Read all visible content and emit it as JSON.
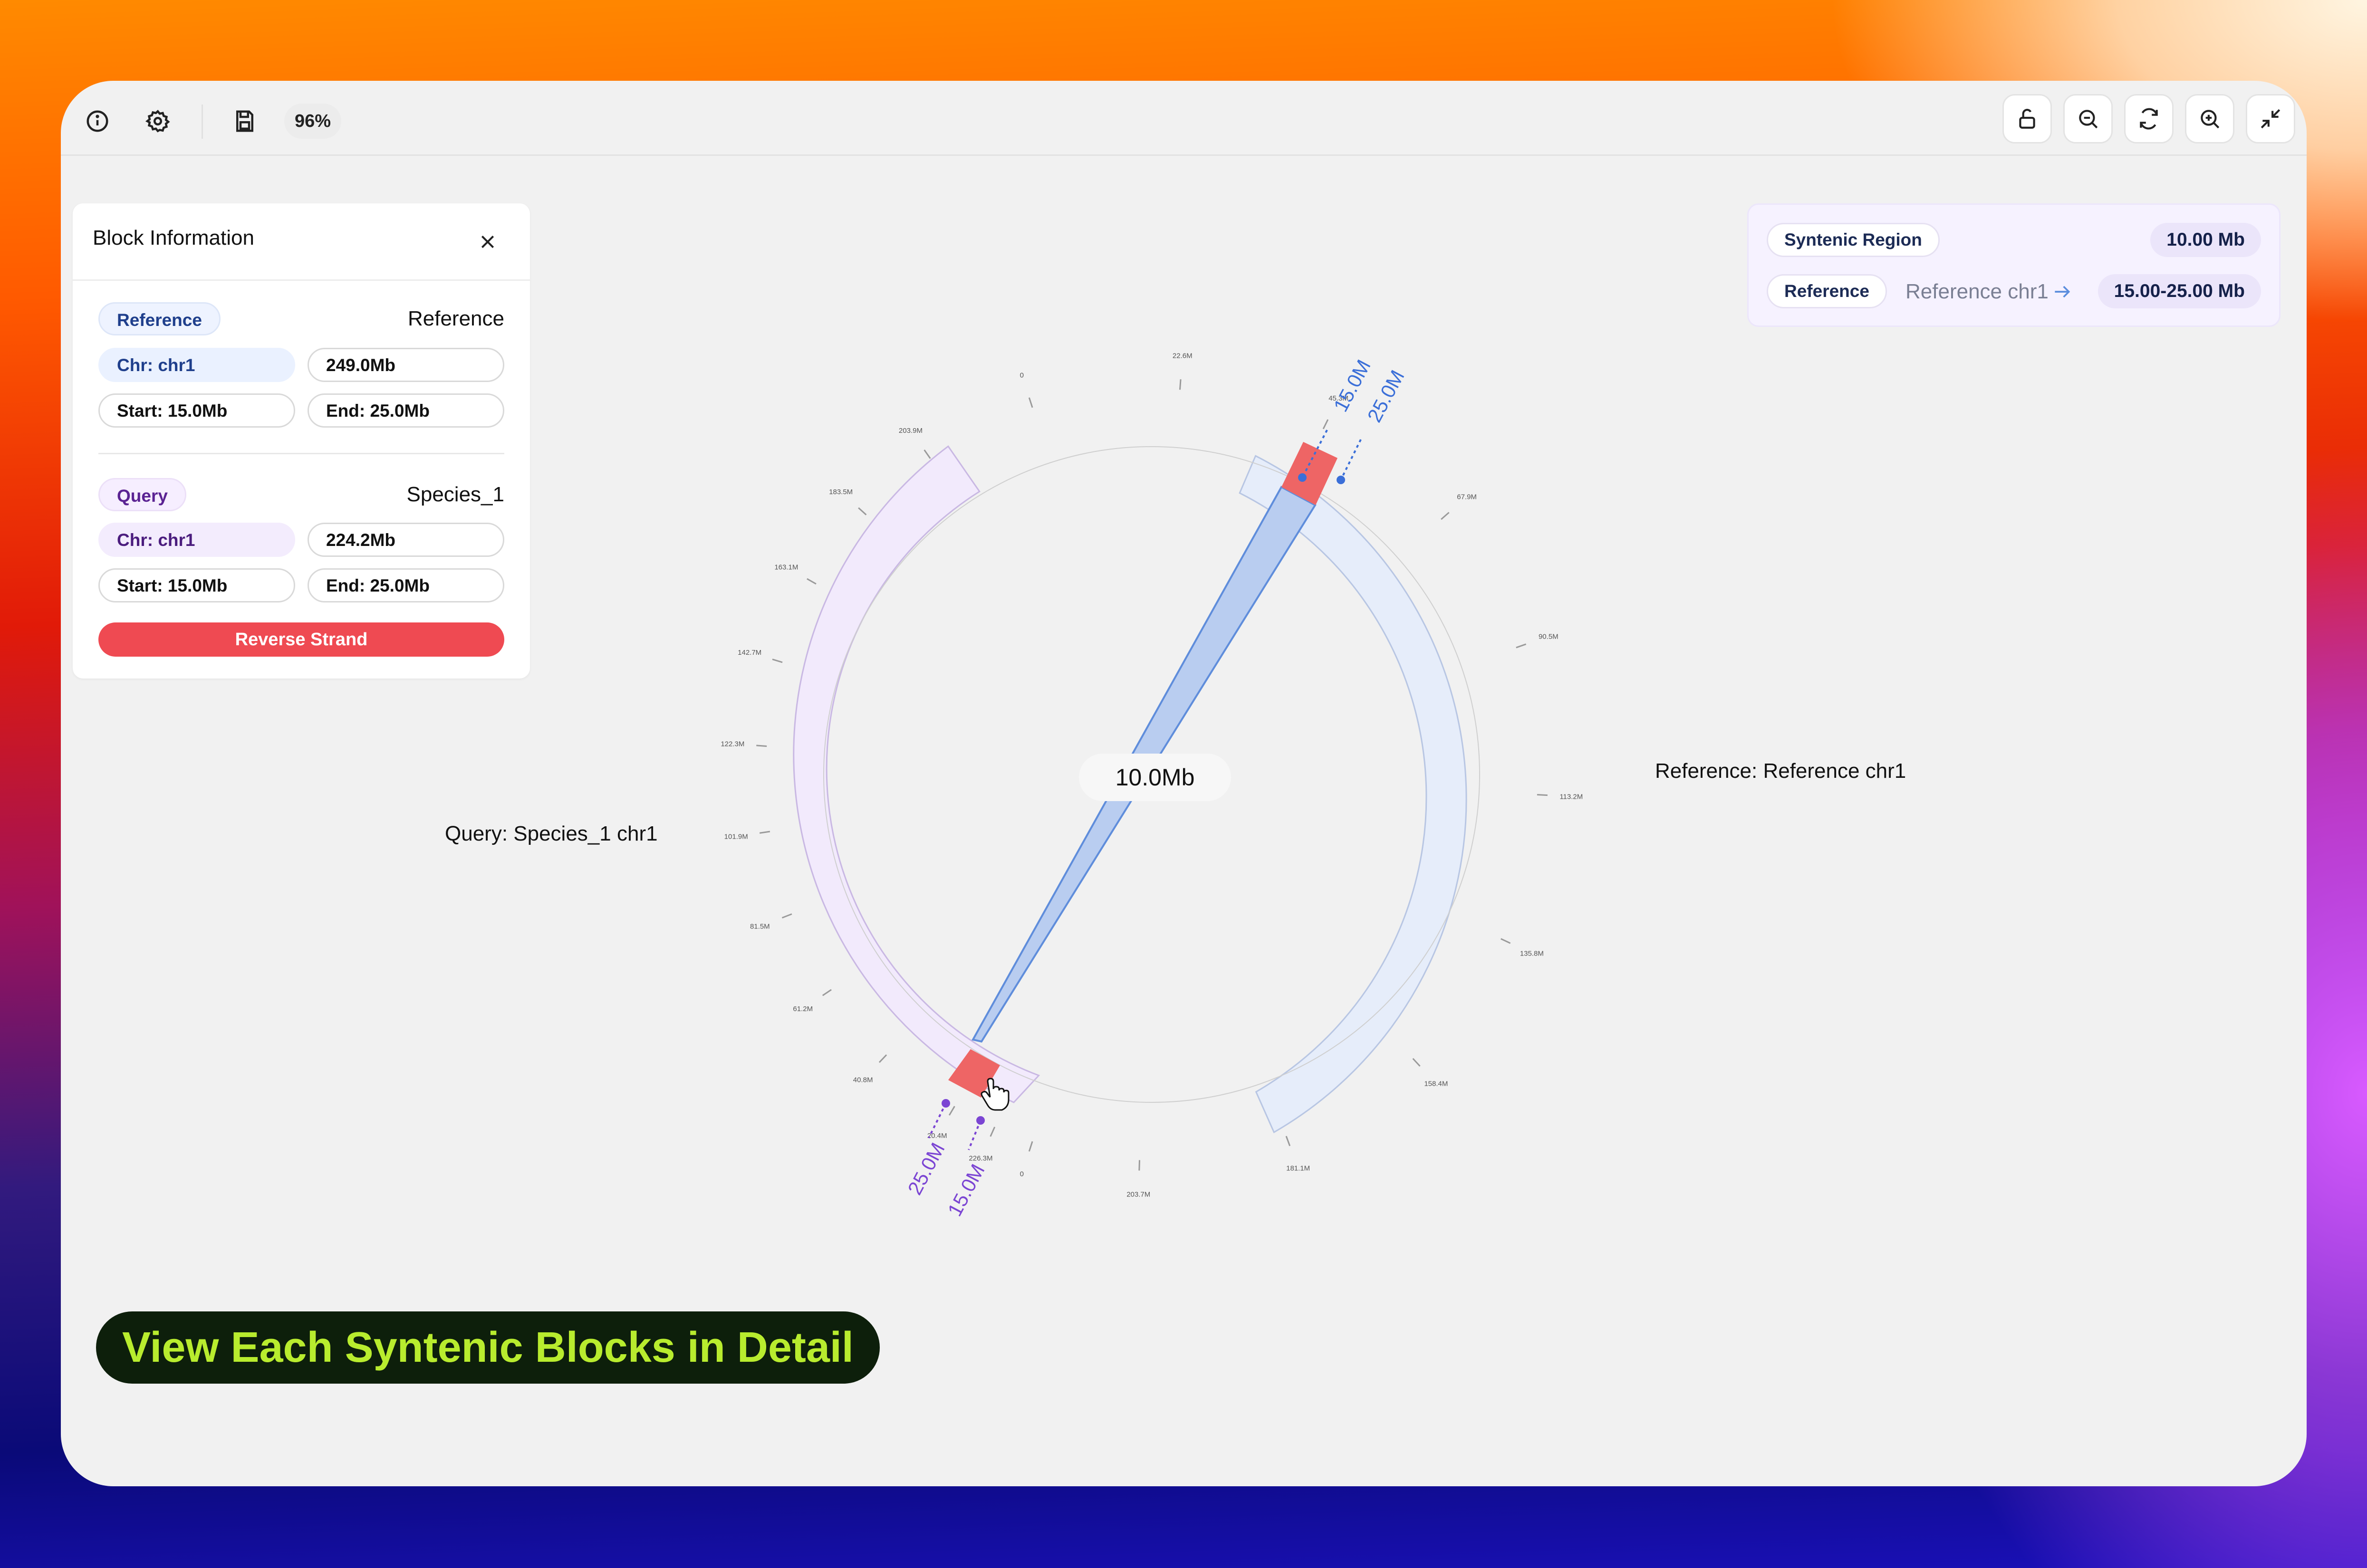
{
  "toolbar": {
    "zoom": "96%",
    "left_icons": [
      "info-icon",
      "settings-icon",
      "save-icon"
    ],
    "right_icons": [
      "unlock-icon",
      "zoom-out-icon",
      "refresh-icon",
      "zoom-in-icon",
      "collapse-icon"
    ]
  },
  "block_info": {
    "title": "Block Information",
    "reference": {
      "tag": "Reference",
      "name": "Reference",
      "chr": "Chr: chr1",
      "length": "249.0Mb",
      "start": "Start: 15.0Mb",
      "end": "End: 25.0Mb"
    },
    "query": {
      "tag": "Query",
      "name": "Species_1",
      "chr": "Chr: chr1",
      "length": "224.2Mb",
      "start": "Start: 15.0Mb",
      "end": "End: 25.0Mb"
    },
    "strand_button": "Reverse Strand"
  },
  "syntenic_panel": {
    "region_label": "Syntenic Region",
    "region_value": "10.00 Mb",
    "ref_tag": "Reference",
    "ref_name": "Reference chr1",
    "ref_range": "15.00-25.00 Mb"
  },
  "chart_data": {
    "type": "circular-synteny",
    "center_label": "10.0Mb",
    "reference": {
      "label": "Reference: Reference chr1",
      "length_mb": 249.0,
      "ticks": [
        "0",
        "22.6M",
        "45.3M",
        "67.9M",
        "90.5M",
        "113.2M",
        "135.8M",
        "158.4M",
        "181.1M",
        "203.7M",
        "226.3M"
      ],
      "block_start_label": "15.0M",
      "block_end_label": "25.0M",
      "color": "#e6edfa"
    },
    "query": {
      "label": "Query: Species_1 chr1",
      "length_mb": 224.2,
      "ticks": [
        "0",
        "20.4M",
        "40.8M",
        "61.2M",
        "81.5M",
        "101.9M",
        "122.3M",
        "142.7M",
        "163.1M",
        "183.5M",
        "203.9M"
      ],
      "block_start_label": "15.0M",
      "block_end_label": "25.0M",
      "color": "#f2eafc"
    },
    "block": {
      "start_mb": 15.0,
      "end_mb": 25.0,
      "highlight_color": "#ee6565",
      "ribbon_color": "#b9cdf0"
    }
  },
  "banner": {
    "text": "View Each Syntenic Blocks in Detail"
  }
}
